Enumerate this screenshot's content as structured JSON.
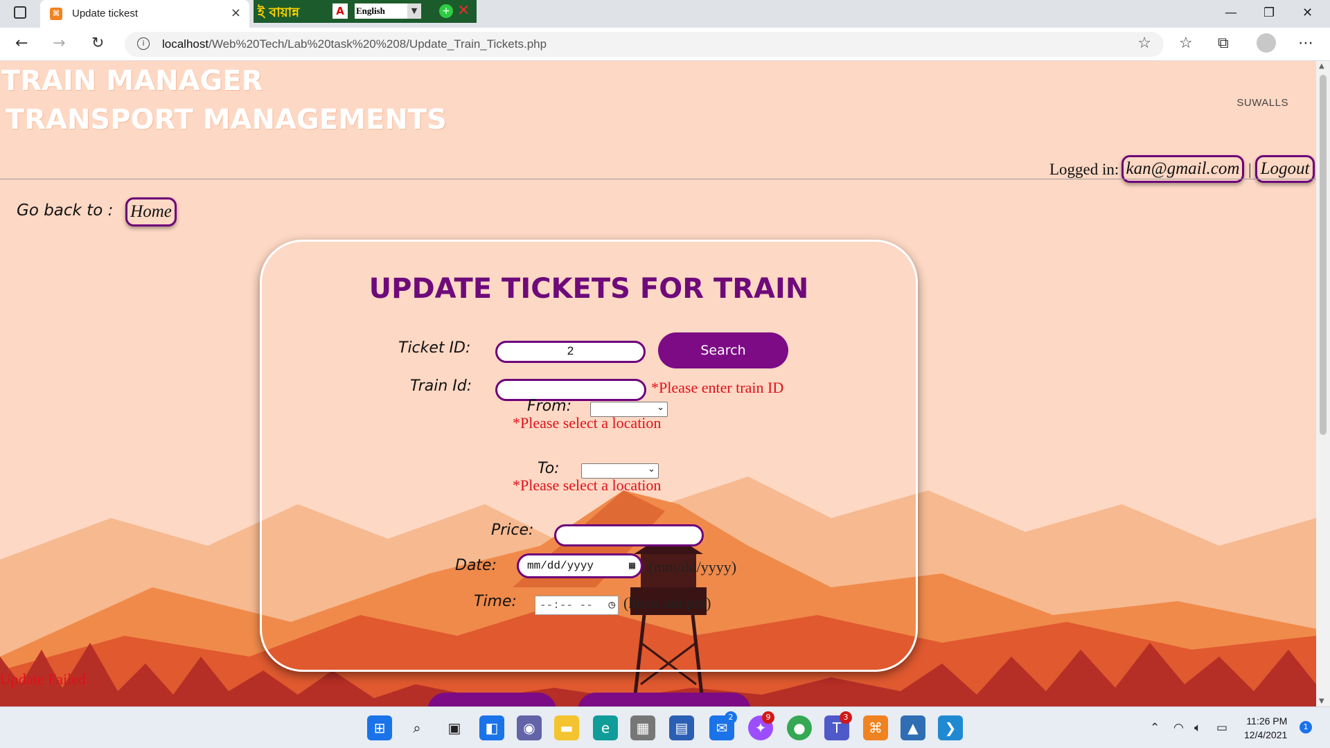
{
  "browser": {
    "tab_title": "Update tickest",
    "tab_close": "×",
    "extension": {
      "bangla_label": "ই বায়ান্ন",
      "language": "English"
    },
    "url_host": "localhost",
    "url_path": "/Web%20Tech/Lab%20task%20%208/Update_Train_Tickets.php"
  },
  "header": {
    "title_line1": "TRAIN MANAGER",
    "title_line2": "TRANSPORT MANAGEMENTS",
    "watermark": "SUWALLS",
    "logged_in_label": "Logged in:",
    "user_email": "kan@gmail.com",
    "separator": "|",
    "logout_label": "Logout"
  },
  "nav": {
    "go_back_label": "Go back to :",
    "home_label": "Home"
  },
  "form": {
    "title": "UPDATE TICKETS FOR TRAIN",
    "ticket_id_label": "Ticket ID:",
    "ticket_id_value": "2",
    "search_label": "Search",
    "train_id_label": "Train Id:",
    "train_id_value": "",
    "train_id_error": "*Please enter train ID",
    "from_label": "From:",
    "from_value": "",
    "from_error": "*Please select a location",
    "to_label": "To:",
    "to_value": "",
    "to_error": "*Please select a location",
    "price_label": "Price:",
    "price_value": "",
    "date_label": "Date:",
    "date_placeholder": "mm/dd/yyyy",
    "date_hint": "(mm/dd/yyyy)",
    "time_label": "Time:",
    "time_placeholder": "--:-- --",
    "time_hint": "(hh:ss am/pm)",
    "status": "Update Failed"
  },
  "taskbar": {
    "time": "11:26 PM",
    "date": "12/4/2021",
    "notification_count": "1",
    "badges": {
      "mail": "2",
      "messenger": "9",
      "teams": "3"
    }
  },
  "colors": {
    "page_bg": "#fdd8c4",
    "accent_purple": "#7c0b85",
    "error_red": "#e0101a",
    "mountain_orange": "#f07a3c",
    "forest_red": "#b62f26"
  }
}
